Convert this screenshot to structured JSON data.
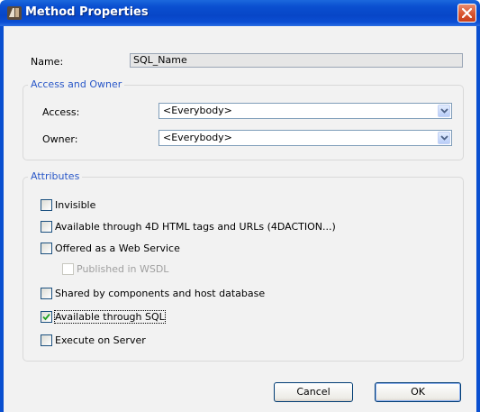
{
  "window": {
    "title": "Method Properties"
  },
  "name_field": {
    "label": "Name:",
    "value": "SQL_Name"
  },
  "access_owner": {
    "legend": "Access and Owner",
    "access_label": "Access:",
    "access_value": "<Everybody>",
    "owner_label": "Owner:",
    "owner_value": "<Everybody>"
  },
  "attributes": {
    "legend": "Attributes",
    "items": [
      {
        "label": "Invisible",
        "checked": false,
        "enabled": true
      },
      {
        "label": "Available through 4D HTML tags and URLs (4DACTION...)",
        "checked": false,
        "enabled": true
      },
      {
        "label": "Offered as a Web Service",
        "checked": false,
        "enabled": true
      },
      {
        "label": "Published in WSDL",
        "checked": false,
        "enabled": false
      },
      {
        "label": "Shared by components and host database",
        "checked": false,
        "enabled": true
      },
      {
        "label": "Available through SQL",
        "checked": true,
        "enabled": true
      },
      {
        "label": "Execute on Server",
        "checked": false,
        "enabled": true
      }
    ]
  },
  "buttons": {
    "cancel": "Cancel",
    "ok": "OK"
  },
  "colors": {
    "titlebar": "#0a4fd0",
    "group_legend": "#2a58c8",
    "close_button": "#d9542e"
  }
}
